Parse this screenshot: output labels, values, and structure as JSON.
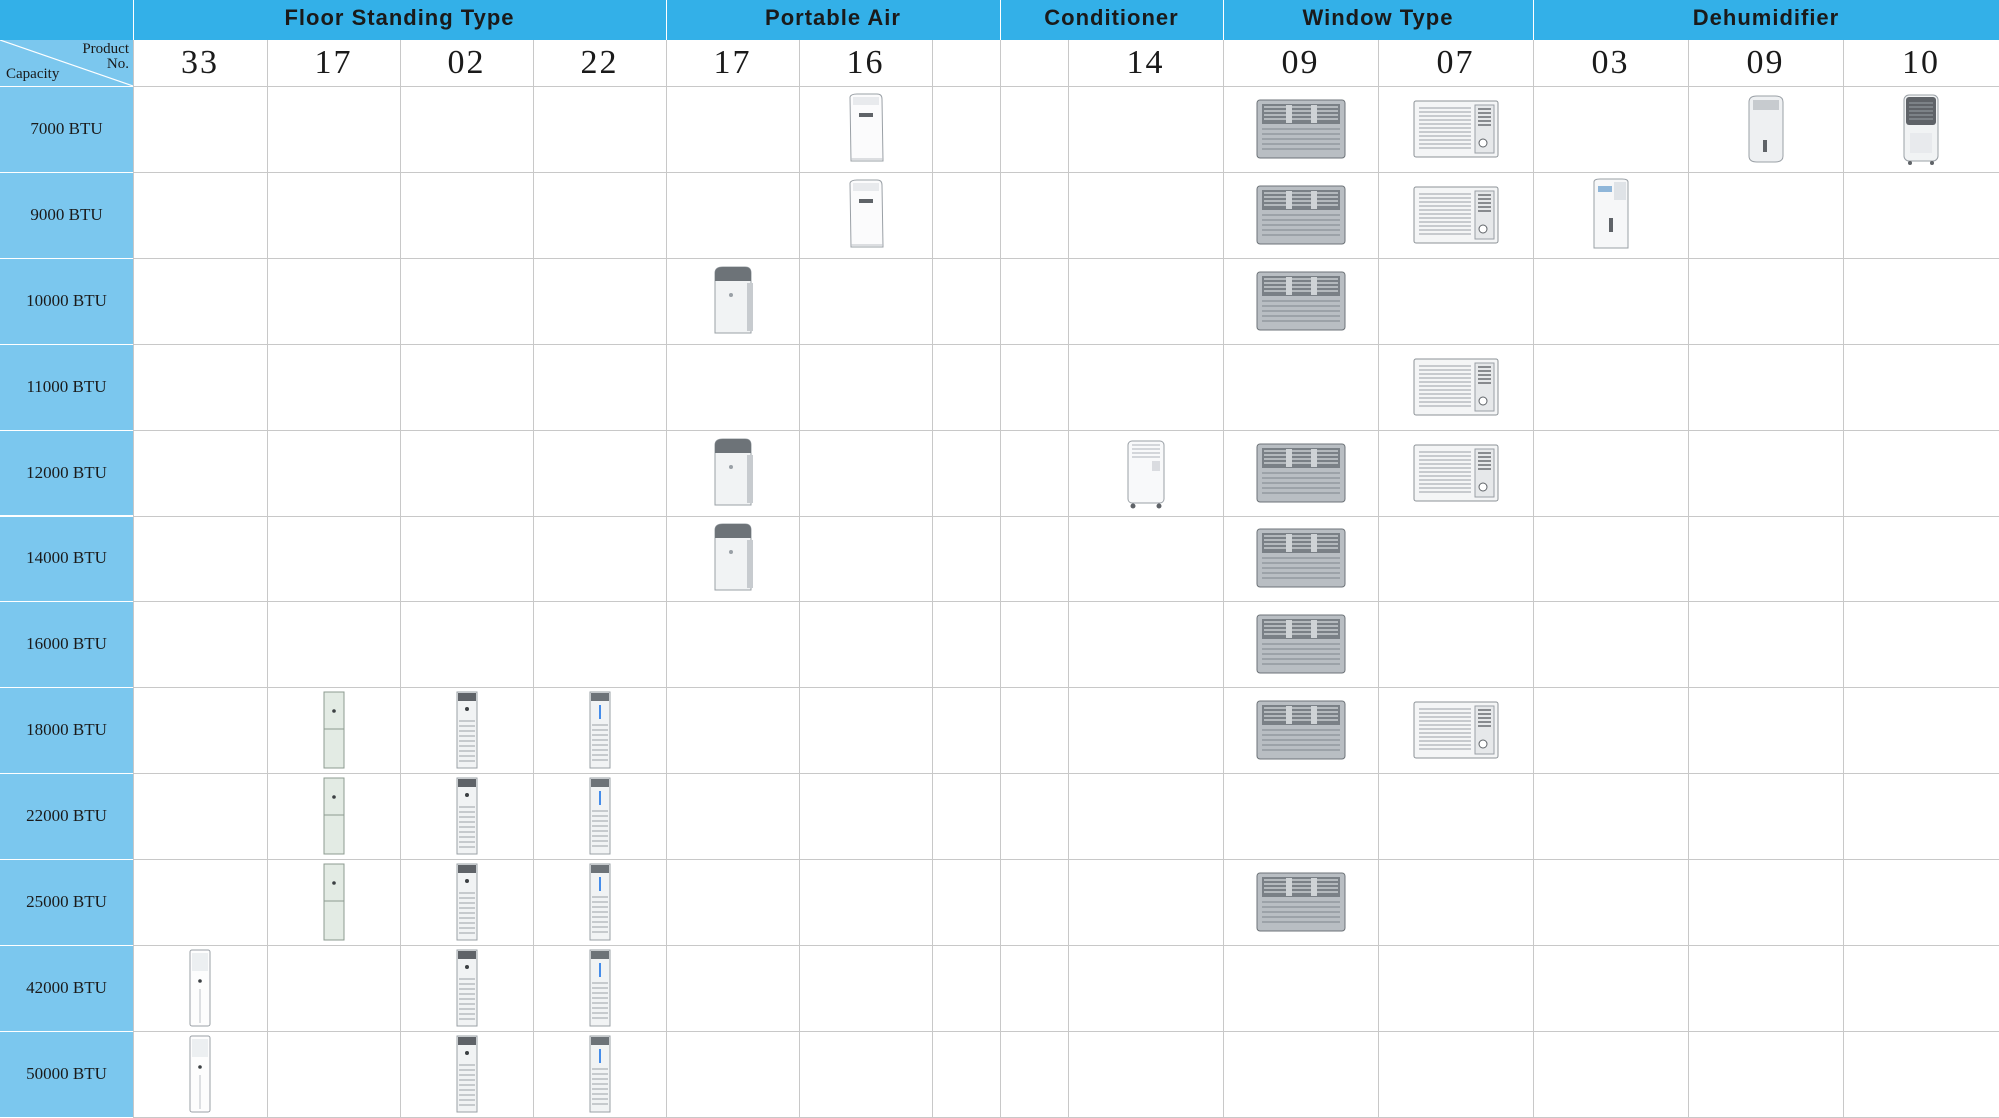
{
  "categories": [
    {
      "label": "Floor Standing Type"
    },
    {
      "label": "Portable Air"
    },
    {
      "label": "Conditioner"
    },
    {
      "label": "Window Type"
    },
    {
      "label": "Dehumidifier"
    }
  ],
  "corner": {
    "product": "Product",
    "no": "No.",
    "capacity": "Capacity"
  },
  "columns": [
    "33",
    "17",
    "02",
    "22",
    "17",
    "16",
    "",
    "",
    "14",
    "09",
    "07",
    "03",
    "09",
    "10"
  ],
  "rows": [
    {
      "label": "7000 BTU",
      "products": [
        null,
        null,
        null,
        null,
        null,
        "portable-b",
        null,
        null,
        null,
        "window-a",
        "window-b",
        null,
        "dehum-a",
        "dehum-b"
      ]
    },
    {
      "label": "9000 BTU",
      "products": [
        null,
        null,
        null,
        null,
        null,
        "portable-b",
        null,
        null,
        null,
        "window-a",
        "window-b",
        "dehum-c",
        null,
        null
      ]
    },
    {
      "label": "10000 BTU",
      "products": [
        null,
        null,
        null,
        null,
        "portable-a",
        null,
        null,
        null,
        null,
        "window-a",
        null,
        null,
        null,
        null
      ]
    },
    {
      "label": "11000 BTU",
      "products": [
        null,
        null,
        null,
        null,
        null,
        null,
        null,
        null,
        null,
        null,
        "window-b",
        null,
        null,
        null
      ]
    },
    {
      "label": "12000 BTU",
      "products": [
        null,
        null,
        null,
        null,
        "portable-a",
        null,
        null,
        null,
        "portable-c",
        "window-a",
        "window-b",
        null,
        null,
        null
      ]
    },
    {
      "label": "14000 BTU",
      "products": [
        null,
        null,
        null,
        null,
        "portable-a",
        null,
        null,
        null,
        null,
        "window-a",
        null,
        null,
        null,
        null
      ]
    },
    {
      "label": "16000 BTU",
      "products": [
        null,
        null,
        null,
        null,
        null,
        null,
        null,
        null,
        null,
        "window-a",
        null,
        null,
        null,
        null
      ]
    },
    {
      "label": "18000 BTU",
      "products": [
        null,
        "floor-b",
        "floor-c",
        "floor-d",
        null,
        null,
        null,
        null,
        null,
        "window-a",
        "window-b",
        null,
        null,
        null
      ]
    },
    {
      "label": "22000 BTU",
      "products": [
        null,
        "floor-b",
        "floor-c",
        "floor-d",
        null,
        null,
        null,
        null,
        null,
        null,
        null,
        null,
        null,
        null
      ]
    },
    {
      "label": "25000 BTU",
      "products": [
        null,
        "floor-b",
        "floor-c",
        "floor-d",
        null,
        null,
        null,
        null,
        null,
        "window-a",
        null,
        null,
        null,
        null
      ]
    },
    {
      "label": "42000 BTU",
      "products": [
        "floor-a",
        null,
        "floor-c",
        "floor-d",
        null,
        null,
        null,
        null,
        null,
        null,
        null,
        null,
        null,
        null
      ]
    },
    {
      "label": "50000 BTU",
      "products": [
        "floor-a",
        null,
        "floor-c",
        "floor-d",
        null,
        null,
        null,
        null,
        null,
        null,
        null,
        null,
        null,
        null
      ]
    }
  ],
  "colors": {
    "header": "#33b0e8",
    "label_bg": "#7bc7ee",
    "grid": "#c8c8c8"
  }
}
